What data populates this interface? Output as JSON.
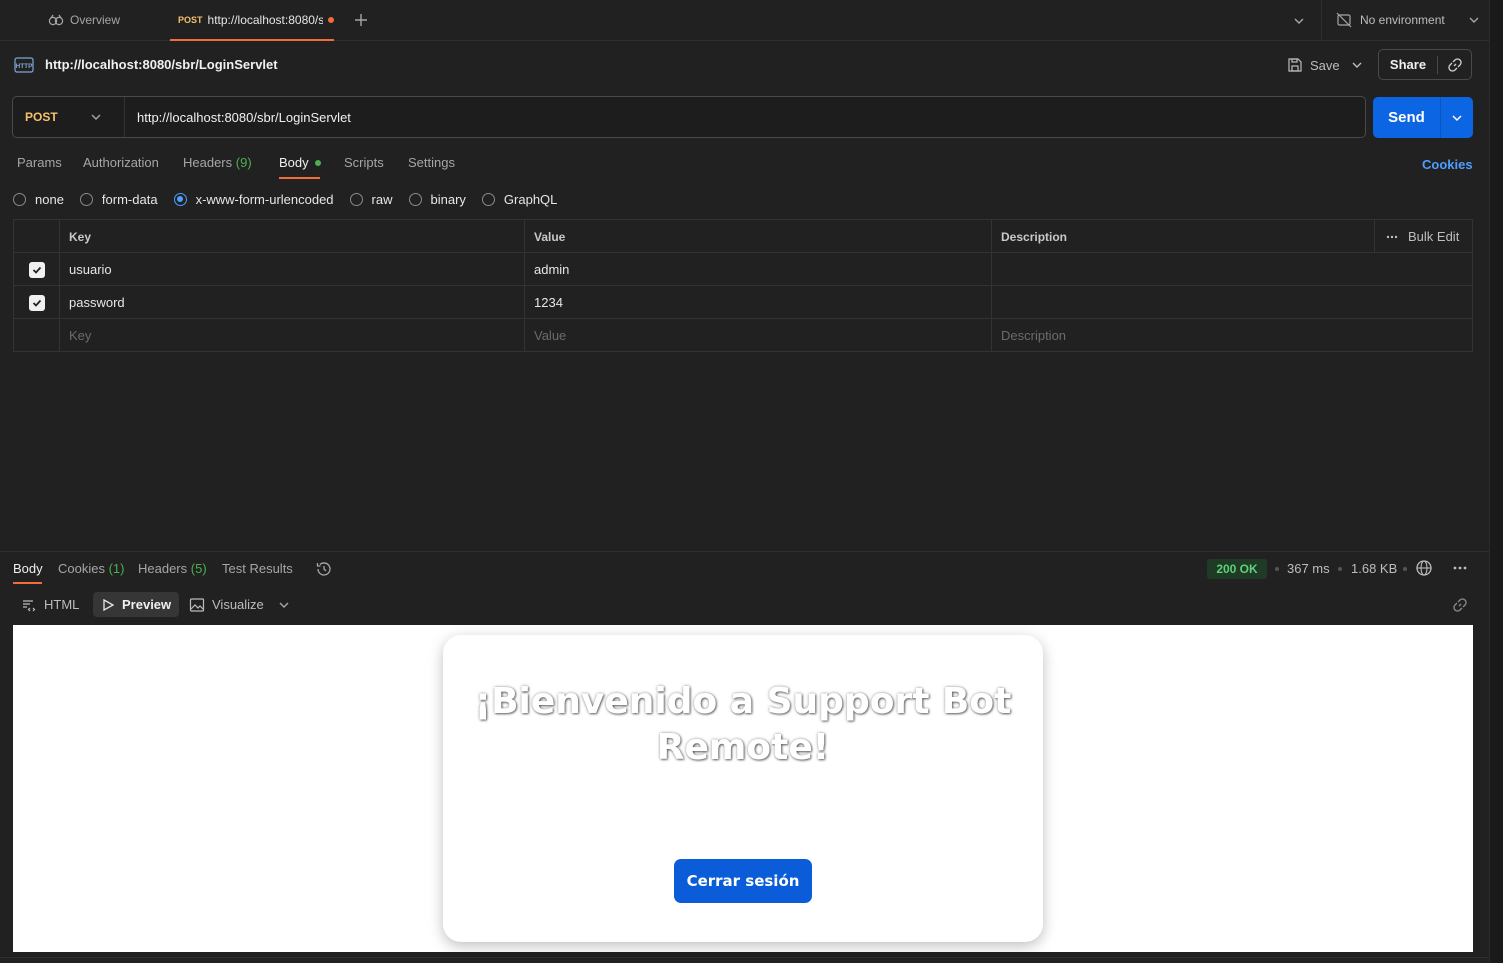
{
  "tabs": {
    "overview_label": "Overview",
    "active_method": "POST",
    "active_title": "http://localhost:8080/sbr/LoginServlet"
  },
  "environment": {
    "label": "No environment"
  },
  "request": {
    "title": "http://localhost:8080/sbr/LoginServlet",
    "save_label": "Save",
    "share_label": "Share",
    "method": "POST",
    "url": "http://localhost:8080/sbr/LoginServlet",
    "send_label": "Send"
  },
  "request_tabs": {
    "params": "Params",
    "authorization": "Authorization",
    "headers": "Headers",
    "headers_count": "(9)",
    "body": "Body",
    "scripts": "Scripts",
    "settings": "Settings",
    "cookies": "Cookies"
  },
  "body_types": {
    "options": [
      "none",
      "form-data",
      "x-www-form-urlencoded",
      "raw",
      "binary",
      "GraphQL"
    ],
    "selected": "x-www-form-urlencoded"
  },
  "params_table": {
    "headers": {
      "key": "Key",
      "value": "Value",
      "description": "Description",
      "bulk_edit": "Bulk Edit"
    },
    "rows": [
      {
        "checked": true,
        "key": "usuario",
        "value": "admin",
        "description": ""
      },
      {
        "checked": true,
        "key": "password",
        "value": "1234",
        "description": ""
      }
    ],
    "placeholders": {
      "key": "Key",
      "value": "Value",
      "description": "Description"
    }
  },
  "response": {
    "tabs": {
      "body": "Body",
      "cookies": "Cookies",
      "cookies_count": "(1)",
      "headers": "Headers",
      "headers_count": "(5)",
      "test_results": "Test Results"
    },
    "status": "200 OK",
    "time": "367 ms",
    "size": "1.68 KB",
    "views": {
      "html": "HTML",
      "preview": "Preview",
      "visualize": "Visualize"
    }
  },
  "preview_page": {
    "heading": "¡Bienvenido a Support Bot Remote!",
    "logout_label": "Cerrar sesión"
  },
  "colors": {
    "accent_orange": "#f26b3a",
    "send_blue": "#0c66e4",
    "method_yellow": "#f5c16c",
    "status_green": "#5fd07a"
  }
}
